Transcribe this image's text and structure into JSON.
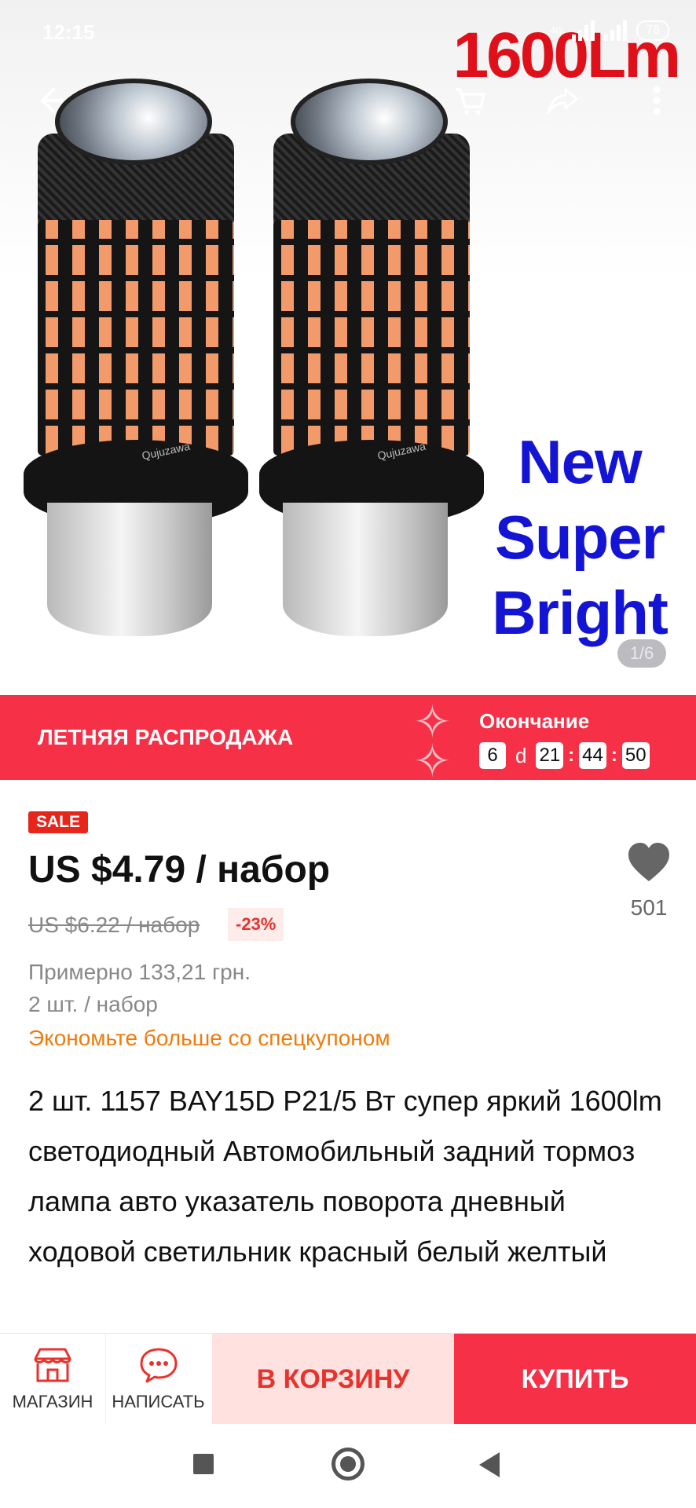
{
  "status_bar": {
    "time": "12:15",
    "network": "4G",
    "battery": "78"
  },
  "hero": {
    "headline": "1600Lm",
    "promo_lines": [
      "New",
      "Super",
      "Bright"
    ],
    "brand_mark": "Qujuzawa",
    "image_counter": "1/6",
    "icons": [
      "back-arrow-icon",
      "cart-icon",
      "share-icon",
      "more-vertical-icon"
    ]
  },
  "sale_banner": {
    "title": "ЛЕТНЯЯ РАСПРОДАЖА",
    "ending_label": "Окончание",
    "days": "6",
    "days_unit": "d",
    "hours": "21",
    "minutes": "44",
    "seconds": "50",
    "color": "#f63046"
  },
  "product": {
    "sale_tag": "SALE",
    "price": "US $4.79 / набор",
    "old_price": "US $6.22 / набор",
    "discount": "-23%",
    "wishlist_count": "501",
    "approx_price": "Примерно 133,21 грн.",
    "per_set": "2 шт. / набор",
    "coupon_text": "Экономьте больше со спецкупоном",
    "title": "2 шт. 1157 BAY15D P21/5 Вт супер яркий 1600lm светодиодный Автомобильный задний тормоз лампа авто указатель поворота дневный ходовой светильник красный белый желтый"
  },
  "action_bar": {
    "store_label": "МАГАЗИН",
    "message_label": "НАПИСАТЬ",
    "add_to_cart_label": "В КОРЗИНУ",
    "buy_label": "КУПИТЬ",
    "accent": "#e8322c"
  }
}
